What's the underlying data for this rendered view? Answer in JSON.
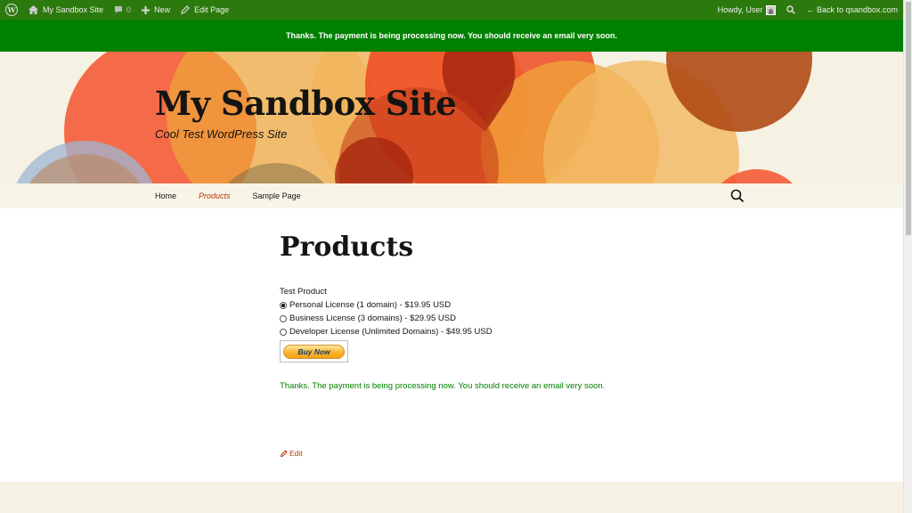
{
  "admin_bar": {
    "site_name": "My Sandbox Site",
    "comments_count": "0",
    "new_label": "New",
    "edit_page_label": "Edit Page",
    "greeting": "Howdy, User",
    "back_link": "← Back to qsandbox.com"
  },
  "notice": {
    "message": "Thanks. The payment is being processing now. You should receive an email very soon."
  },
  "header": {
    "site_title": "My Sandbox Site",
    "site_description": "Cool Test WordPress Site"
  },
  "nav": {
    "items": [
      {
        "label": "Home",
        "current": false
      },
      {
        "label": "Products",
        "current": true
      },
      {
        "label": "Sample Page",
        "current": false
      }
    ]
  },
  "main": {
    "page_title": "Products",
    "product_label": "Test Product",
    "options": [
      {
        "label": "Personal License (1 domain) - $19.95 USD",
        "selected": true
      },
      {
        "label": "Business License (3 domains) - $29.95 USD",
        "selected": false
      },
      {
        "label": "Developer License (Unlimited Domains) - $49.95 USD",
        "selected": false
      }
    ],
    "buy_now_label": "Buy Now",
    "success_message": "Thanks. The payment is being processing now. You should receive an email very soon.",
    "edit_label": "Edit"
  },
  "colors": {
    "admin_bar_bg": "#2c7a0e",
    "notice_bg": "#008000",
    "accent": "#bc360a",
    "success_text": "#008000"
  }
}
